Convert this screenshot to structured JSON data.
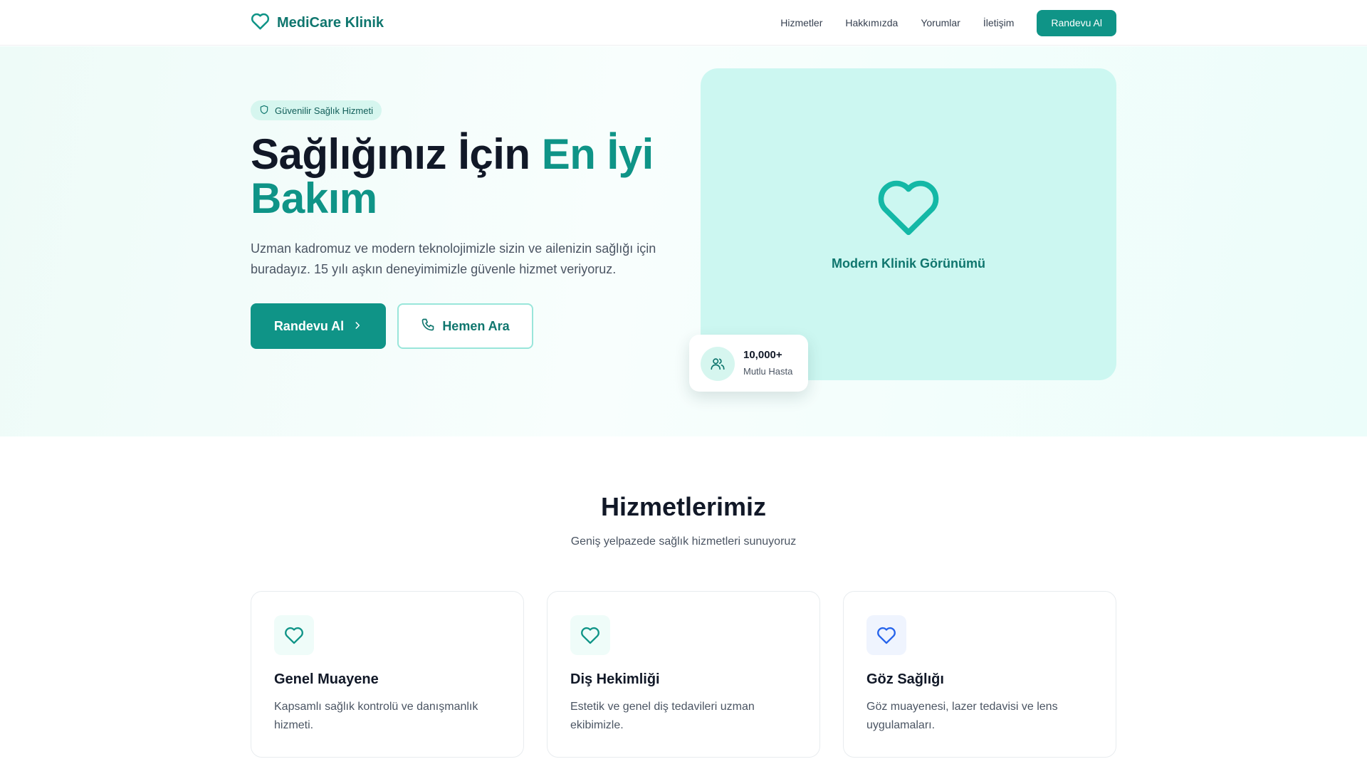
{
  "brand": {
    "name": "MediCare Klinik",
    "icon": "heart-icon"
  },
  "nav": {
    "links": [
      "Hizmetler",
      "Hakkımızda",
      "Yorumlar",
      "İletişim"
    ],
    "cta": "Randevu Al"
  },
  "hero": {
    "badge": {
      "icon": "shield-icon",
      "text": "Güvenilir Sağlık Hizmeti"
    },
    "headline_part1": "Sağlığınız İçin ",
    "headline_accent": "En İyi Bakım",
    "lead": "Uzman kadromuz ve modern teknolojimizle sizin ve ailenizin sağlığı için buradayız. 15 yılı aşkın deneyimimizle güvenle hizmet veriyoruz.",
    "primary_button": {
      "label": "Randevu Al",
      "icon": "chevron-right-icon"
    },
    "secondary_button": {
      "label": "Hemen Ara",
      "icon": "phone-icon"
    },
    "card": {
      "icon": "heart-icon",
      "label": "Modern Klinik Görünümü"
    },
    "stat": {
      "icon": "users-icon",
      "value": "10,000+",
      "label": "Mutlu Hasta"
    }
  },
  "services": {
    "title": "Hizmetlerimiz",
    "subtitle": "Geniş yelpazede sağlık hizmetleri sunuyoruz",
    "items": [
      {
        "title": "Genel Muayene",
        "description": "Kapsamlı sağlık kontrolü ve danışmanlık hizmeti.",
        "icon": "heart-icon",
        "icon_color": "#0f9487",
        "icon_bg": "#effcf9"
      },
      {
        "title": "Diş Hekimliği",
        "description": "Estetik ve genel diş tedavileri uzman ekibimizle.",
        "icon": "heart-icon",
        "icon_color": "#0f9487",
        "icon_bg": "#effcf9"
      },
      {
        "title": "Göz Sağlığı",
        "description": "Göz muayenesi, lazer tedavisi ve lens uygulamaları.",
        "icon": "heart-icon",
        "icon_color": "#2563eb",
        "icon_bg": "#eff4fe"
      }
    ]
  },
  "colors": {
    "primary": "#0f9487",
    "primary_dark": "#0f766e",
    "hero_card": "#ccf7f1"
  }
}
